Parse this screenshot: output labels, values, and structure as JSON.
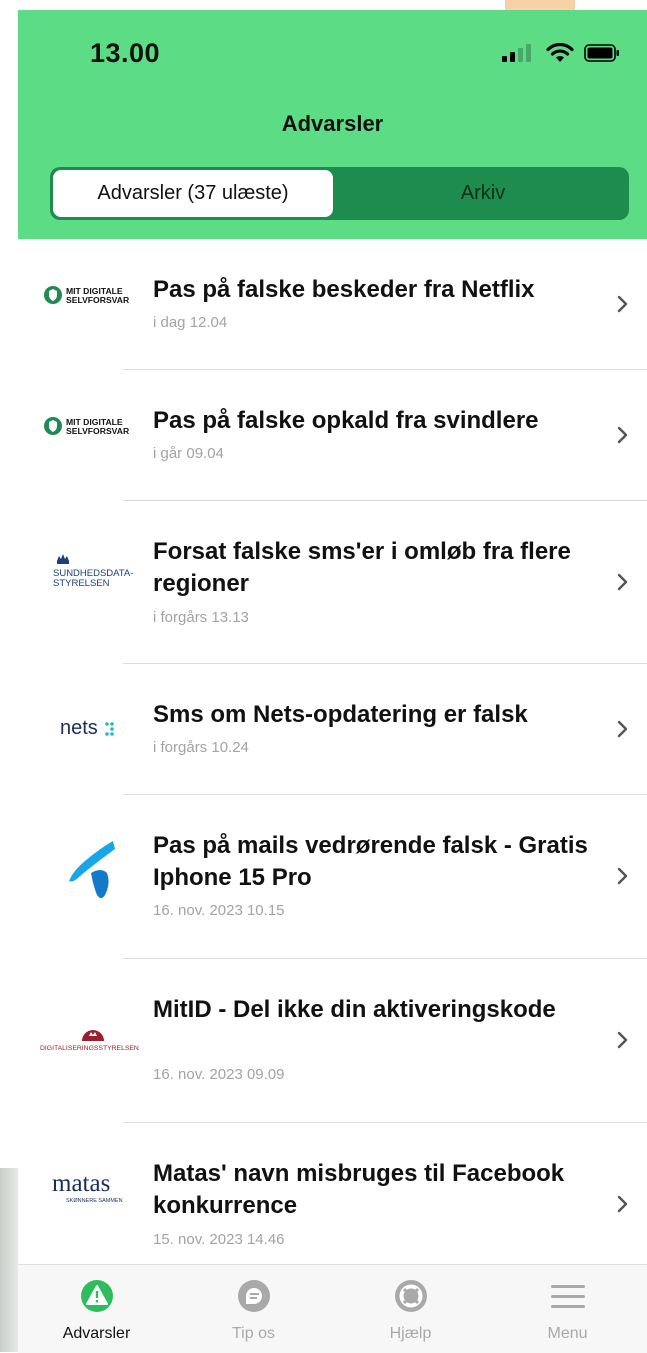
{
  "status_bar": {
    "time": "13.00"
  },
  "header": {
    "title": "Advarsler"
  },
  "segments": {
    "active": "Advarsler (37 ulæste)",
    "inactive": "Arkiv"
  },
  "alerts": [
    {
      "logo": "MIT DIGITALE SELVFORSVAR",
      "title": "Pas på falske beskeder fra Netflix",
      "date": "i dag 12.04"
    },
    {
      "logo": "MIT DIGITALE SELVFORSVAR",
      "title": "Pas på falske opkald fra svindlere",
      "date": "i går 09.04"
    },
    {
      "logo": "SUNDHEDSDATA-STYRELSEN",
      "title": "Forsat falske sms'er i omløb fra flere regioner",
      "date": "i forgårs 13.13"
    },
    {
      "logo": "nets",
      "title": "Sms om Nets-opdatering er falsk",
      "date": "i forgårs 10.24"
    },
    {
      "logo": "telenor-icon",
      "title": "Pas på mails vedrørende falsk - Gratis Iphone 15 Pro",
      "date": "16. nov. 2023 10.15"
    },
    {
      "logo": "DIGITALISERINGSSTYRELSEN",
      "title": "MitID - Del ikke din aktiveringskode",
      "date": "16. nov. 2023 09.09"
    },
    {
      "logo": "matas",
      "logo_sub": "SKØNNERE SAMMEN",
      "title": "Matas' navn misbruges til Facebook konkurrence",
      "date": "15. nov. 2023 14.46"
    }
  ],
  "tabs": [
    {
      "label": "Advarsler",
      "icon": "alert-icon"
    },
    {
      "label": "Tip os",
      "icon": "chat-icon"
    },
    {
      "label": "Hjælp",
      "icon": "lifebuoy-icon"
    },
    {
      "label": "Menu",
      "icon": "menu-icon"
    }
  ],
  "colors": {
    "header_green": "#5cdc84",
    "segment_dark": "#1e8c4f",
    "active_tab_green": "#2ebd5c"
  }
}
